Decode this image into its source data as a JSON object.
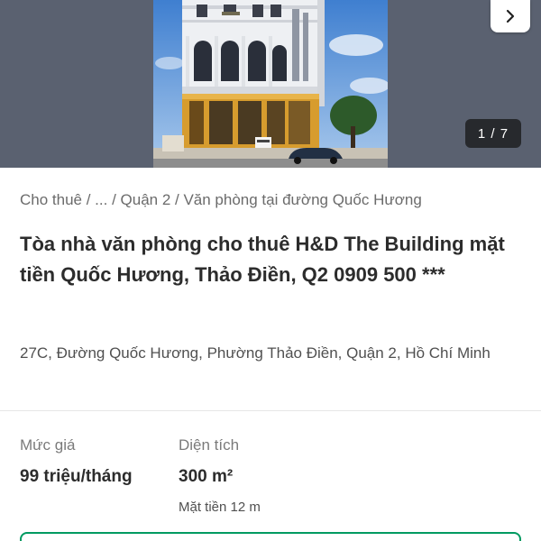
{
  "gallery": {
    "counter": "1 / 7",
    "next_icon": "chevron-right-icon",
    "sign_text": "H&D BUILDING"
  },
  "breadcrumb": {
    "items": [
      "Cho thuê",
      "...",
      "Quận 2",
      "Văn phòng tại đường Quốc Hương"
    ],
    "separator": " / "
  },
  "listing": {
    "title": "Tòa nhà văn phòng cho thuê H&D The Building mặt tiền Quốc Hương, Thảo Điền, Q2 0909 500 ***",
    "address": "27C, Đường Quốc Hương, Phường Thảo Điền, Quận 2, Hồ Chí Minh"
  },
  "stats": {
    "price_label": "Mức giá",
    "price_value": "99 triệu/tháng",
    "area_label": "Diện tích",
    "area_value": "300 m²",
    "area_sub": "Mặt tiền 12 m"
  },
  "colors": {
    "accent": "#009a61",
    "gallery_bg": "#5a6170"
  }
}
